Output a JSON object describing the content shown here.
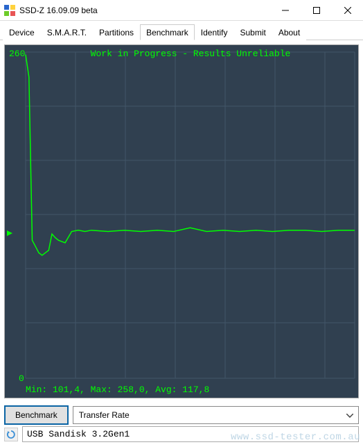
{
  "window": {
    "title": "SSD-Z 16.09.09 beta"
  },
  "tabs": [
    {
      "label": "Device",
      "active": false
    },
    {
      "label": "S.M.A.R.T.",
      "active": false
    },
    {
      "label": "Partitions",
      "active": false
    },
    {
      "label": "Benchmark",
      "active": true
    },
    {
      "label": "Identify",
      "active": false
    },
    {
      "label": "Submit",
      "active": false
    },
    {
      "label": "About",
      "active": false
    }
  ],
  "chart_data": {
    "type": "line",
    "title": "Work in Progress - Results Unreliable",
    "xlabel": "",
    "ylabel": "",
    "ylim": [
      0,
      260
    ],
    "y_top_label": "260",
    "y_bottom_label": "0",
    "grid": true,
    "x": [
      0,
      1,
      2,
      3,
      4,
      5,
      6,
      7,
      8,
      9,
      10,
      12,
      14,
      16,
      18,
      20,
      25,
      30,
      35,
      40,
      45,
      50,
      55,
      60,
      65,
      70,
      75,
      80,
      85,
      90,
      95,
      100
    ],
    "values": [
      258,
      240,
      110,
      105,
      100,
      98,
      100,
      102,
      115,
      112,
      110,
      108,
      117,
      118,
      117,
      118,
      117,
      118,
      117,
      118,
      117,
      120,
      117,
      118,
      117,
      118,
      117,
      118,
      118,
      117,
      118,
      118
    ],
    "stats_text": "Min: 101,4, Max: 258,0, Avg: 117,8",
    "stats": {
      "min": 101.4,
      "max": 258.0,
      "avg": 117.8
    }
  },
  "controls": {
    "benchmark_button": "Benchmark",
    "mode_select": "Transfer Rate"
  },
  "status": {
    "device": "USB Sandisk 3.2Gen1"
  },
  "watermark": "www.ssd-tester.com.au"
}
